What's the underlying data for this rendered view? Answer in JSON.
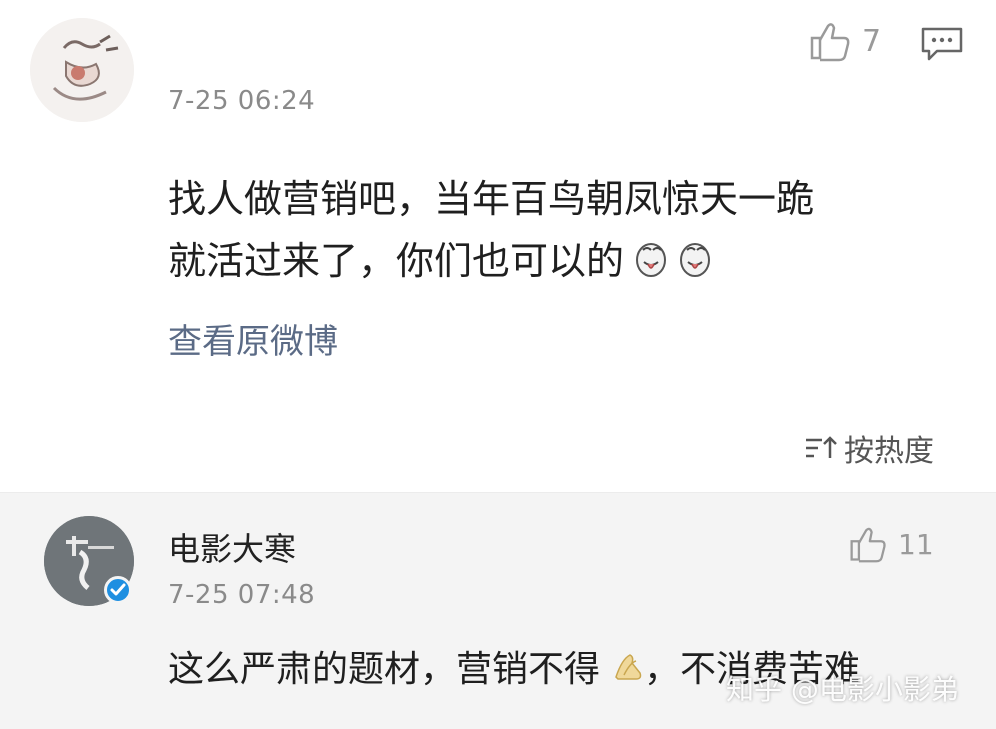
{
  "comment": {
    "time": "7-25 06:24",
    "text_line1": "找人做营销吧，当年百鸟朝凤惊天一跪",
    "text_line2": "就活过来了，你们也可以的",
    "emoji_name": "tongue-face-emoji",
    "like_count": "7",
    "view_original": "查看原微博"
  },
  "sort": {
    "label": "按热度"
  },
  "reply": {
    "username": "电影大寒",
    "time": "7-25 07:48",
    "text_before": "这么严肃的题材，营销不得",
    "text_after": "，不消费苦难",
    "emoji_name": "praying-hands-emoji",
    "like_count": "11"
  },
  "watermark": "知乎 @电影小影弟",
  "colors": {
    "link": "#5b6b86",
    "meta": "#8a8a8a",
    "verified": "#1e8fe1",
    "reply_bg": "#f4f4f4"
  }
}
